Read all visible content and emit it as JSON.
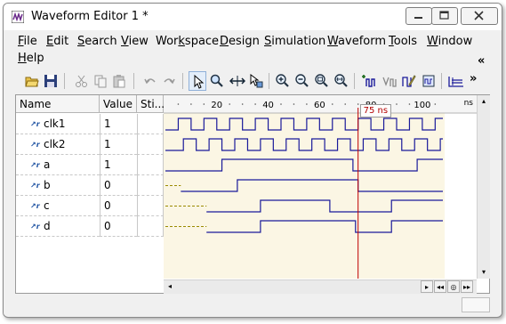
{
  "window": {
    "title": "Waveform Editor 1 *"
  },
  "menu": [
    "File",
    "Edit",
    "Search",
    "View",
    "Workspace",
    "Design",
    "Simulation",
    "Waveform",
    "Tools",
    "Window",
    "Help"
  ],
  "menu_underline": [
    "F",
    "E",
    "S",
    "V",
    "k",
    "D",
    "S",
    "W",
    "T",
    "W",
    "H"
  ],
  "menu_overflow": "«",
  "toolbar_overflow": "»",
  "toolbar_icons": [
    "open-folder-icon",
    "save-icon",
    "cut-icon",
    "copy-icon",
    "paste-icon",
    "undo-icon",
    "redo-icon",
    "select-pointer-icon",
    "zoom-mode-icon",
    "measure-icon",
    "pointer-plus-icon",
    "zoom-in-icon",
    "zoom-out-icon",
    "zoom-range-icon",
    "zoom-fit-icon",
    "add-signal-icon",
    "formula-icon",
    "edit-signal-icon",
    "bus-icon"
  ],
  "columns": {
    "name": "Name",
    "value": "Value",
    "stim": "Sti..."
  },
  "timeline": {
    "unit": "ns",
    "ticks": [
      "20",
      "40",
      "60",
      "80",
      "100"
    ],
    "cursor_label": "75 ns",
    "cursor_time": 75,
    "range": [
      0,
      108
    ]
  },
  "signals": [
    {
      "name": "clk1",
      "value": "1"
    },
    {
      "name": "clk2",
      "value": "1"
    },
    {
      "name": "a",
      "value": "1"
    },
    {
      "name": "b",
      "value": "0"
    },
    {
      "name": "c",
      "value": "0"
    },
    {
      "name": "d",
      "value": "0"
    }
  ],
  "hscroll": {
    "left": "◂",
    "right": "▸",
    "first": "◂◂",
    "stop": "◎",
    "last": "▸▸"
  },
  "vscroll": {
    "up": "▴",
    "down": "▾"
  },
  "colors": {
    "waveform": "#1a1a9a",
    "cursor": "#c00000",
    "pane_bg": "#fbf6e4",
    "undefined": "#9a8a00"
  }
}
